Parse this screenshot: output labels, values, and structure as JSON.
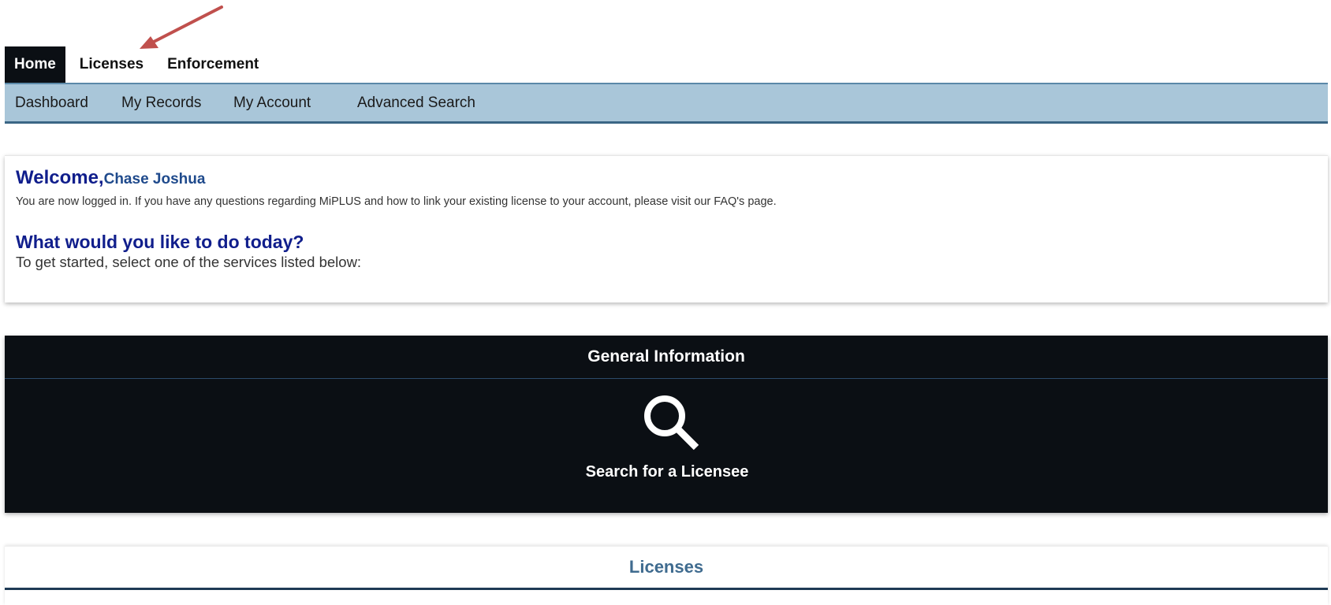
{
  "main_nav": {
    "tabs": [
      {
        "label": "Home",
        "active": true
      },
      {
        "label": "Licenses",
        "active": false
      },
      {
        "label": "Enforcement",
        "active": false
      }
    ]
  },
  "sub_nav": {
    "items": [
      {
        "label": "Dashboard"
      },
      {
        "label": "My Records"
      },
      {
        "label": "My Account"
      },
      {
        "label": "Advanced Search"
      }
    ]
  },
  "welcome": {
    "greeting": "Welcome,",
    "user_name": "Chase Joshua",
    "message": "You are now logged in. If you have any questions regarding MiPLUS and how to link your existing license to your account, please visit our FAQ's page.",
    "question": "What would you like to do today?",
    "instruction": "To get started, select one of the services listed below:"
  },
  "general_information": {
    "title": "General Information",
    "tile": {
      "icon": "search-icon",
      "label": "Search for a Licensee"
    }
  },
  "licenses_section": {
    "title": "Licenses"
  },
  "colors": {
    "dark_panel": "#0b0f14",
    "subnav_bg": "#a9c6d9",
    "heading_blue": "#101e8c",
    "annotation_arrow": "#c0504d"
  },
  "annotation": {
    "icon": "arrow-annotation-icon"
  }
}
